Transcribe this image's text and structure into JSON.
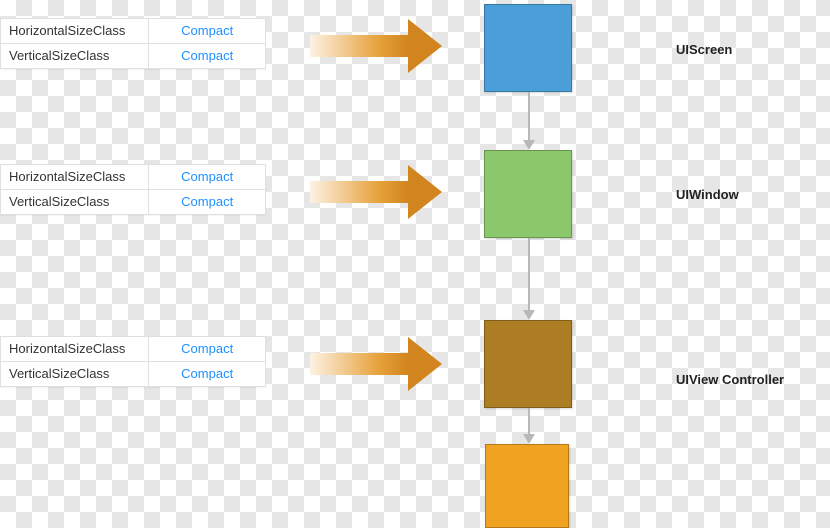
{
  "traits": [
    {
      "horizontal_key": "HorizontalSizeClass",
      "horizontal_val": "Compact",
      "vertical_key": "VerticalSizeClass",
      "vertical_val": "Compact"
    },
    {
      "horizontal_key": "HorizontalSizeClass",
      "horizontal_val": "Compact",
      "vertical_key": "VerticalSizeClass",
      "vertical_val": "Compact"
    },
    {
      "horizontal_key": "HorizontalSizeClass",
      "horizontal_val": "Compact",
      "vertical_key": "VerticalSizeClass",
      "vertical_val": "Compact"
    }
  ],
  "nodes": [
    {
      "label": "UIScreen",
      "color": "#4a9fd8"
    },
    {
      "label": "UIWindow",
      "color": "#8bc86b"
    },
    {
      "label": "UIView Controller",
      "color": "#ad7d24"
    }
  ],
  "extra_node_color": "#f0a321"
}
